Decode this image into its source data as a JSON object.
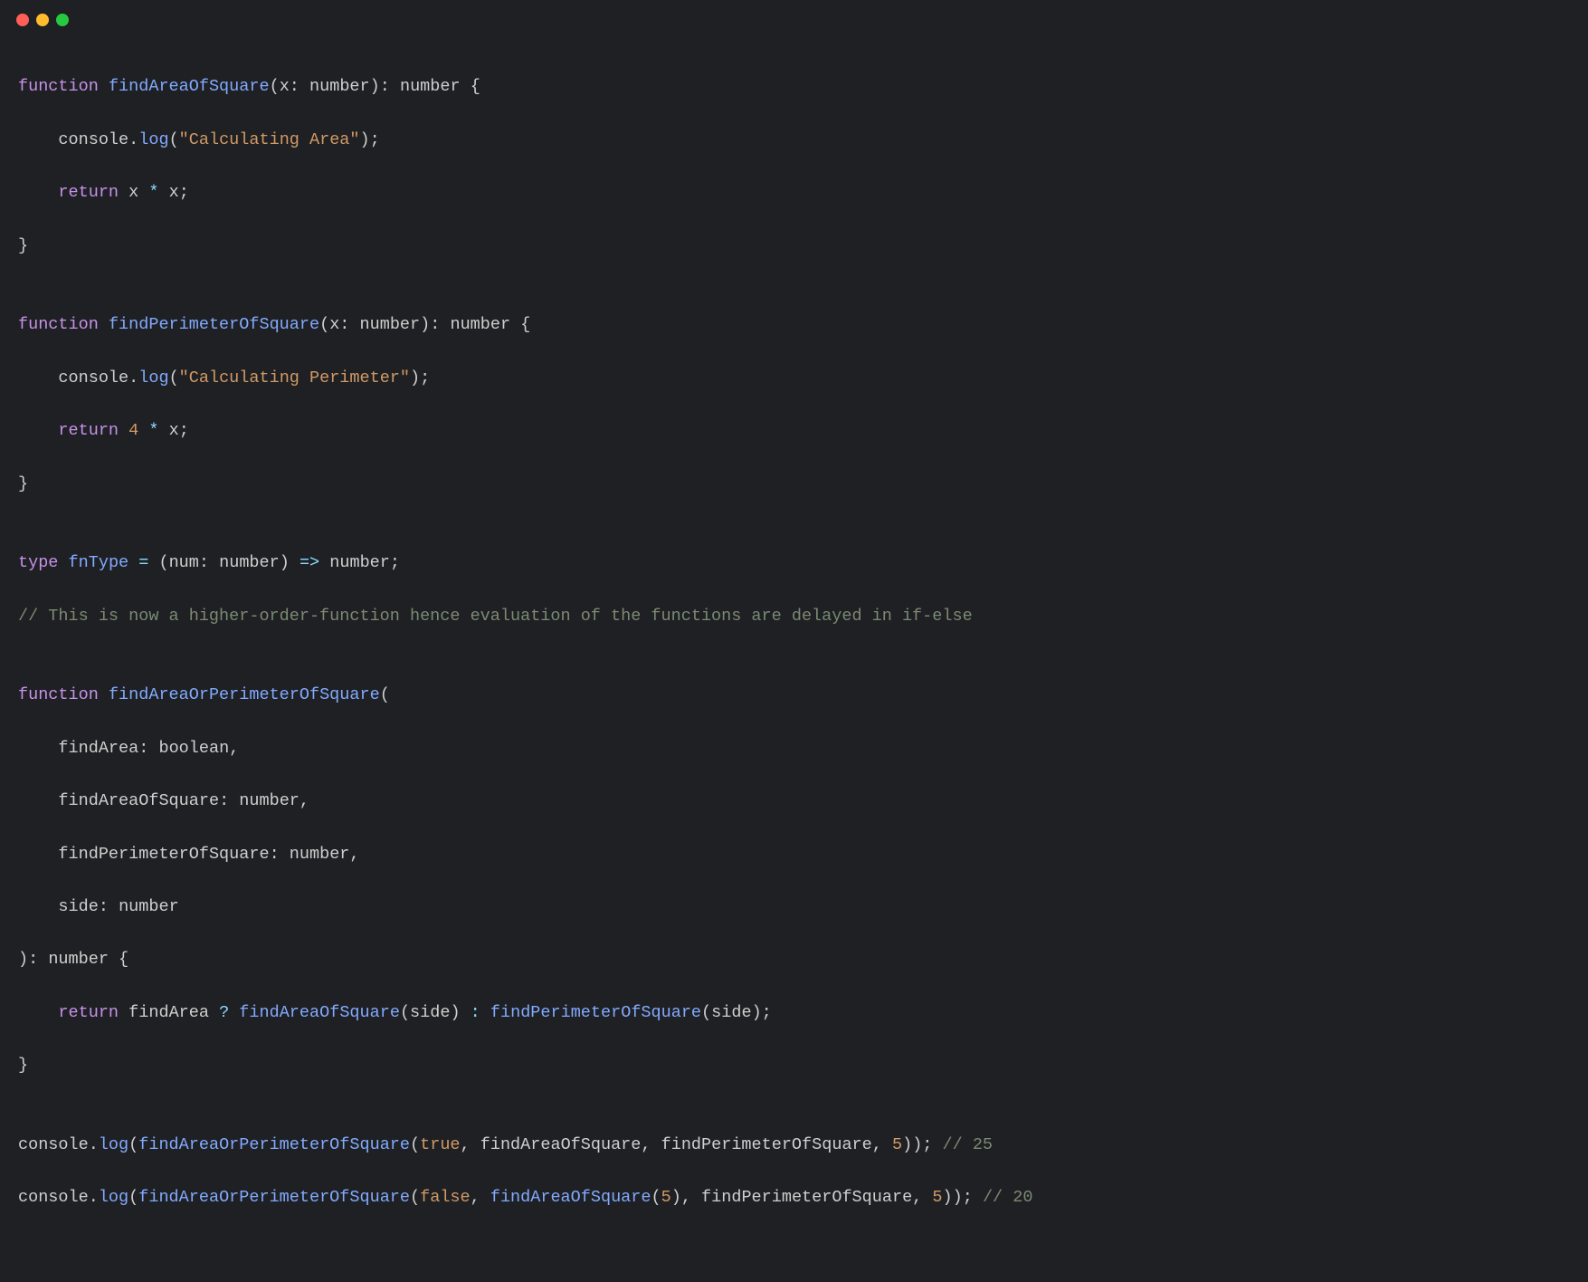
{
  "code": {
    "l1": {
      "kw": "function",
      "fn": "findAreaOfSquare",
      "p": "(",
      "param": "x",
      "colon": ": ",
      "ptype": "number",
      "cp": ")",
      "rcolon": ": ",
      "rtype": "number",
      "ob": " {"
    },
    "l2": {
      "indent": "    ",
      "obj": "console",
      "dot": ".",
      "method": "log",
      "p": "(",
      "str": "\"Calculating Area\"",
      "cp": ")",
      "semi": ";"
    },
    "l3": {
      "indent": "    ",
      "kw": "return",
      "sp": " ",
      "a": "x",
      "op": " * ",
      "b": "x",
      "semi": ";"
    },
    "l4": {
      "cb": "}"
    },
    "l5": {
      "blank": ""
    },
    "l6": {
      "kw": "function",
      "fn": "findPerimeterOfSquare",
      "p": "(",
      "param": "x",
      "colon": ": ",
      "ptype": "number",
      "cp": ")",
      "rcolon": ": ",
      "rtype": "number",
      "ob": " {"
    },
    "l7": {
      "indent": "    ",
      "obj": "console",
      "dot": ".",
      "method": "log",
      "p": "(",
      "str": "\"Calculating Perimeter\"",
      "cp": ")",
      "semi": ";"
    },
    "l8": {
      "indent": "    ",
      "kw": "return",
      "sp": " ",
      "a": "4",
      "op": " * ",
      "b": "x",
      "semi": ";"
    },
    "l9": {
      "cb": "}"
    },
    "l10": {
      "blank": ""
    },
    "l11": {
      "kw": "type",
      "sp": " ",
      "name": "fnType",
      "eq": " = ",
      "p": "(",
      "param": "num",
      "colon": ": ",
      "ptype": "number",
      "cp": ")",
      "arrow": " => ",
      "rtype": "number",
      "semi": ";"
    },
    "l12": {
      "comment": "// This is now a higher-order-function hence evaluation of the functions are delayed in if-else"
    },
    "l13": {
      "blank": ""
    },
    "l14": {
      "kw": "function",
      "fn": "findAreaOrPerimeterOfSquare",
      "p": "("
    },
    "l15": {
      "indent": "    ",
      "param": "findArea",
      "colon": ": ",
      "ptype": "boolean",
      "comma": ","
    },
    "l16": {
      "indent": "    ",
      "param": "findAreaOfSquare",
      "colon": ": ",
      "ptype": "number",
      "comma": ","
    },
    "l17": {
      "indent": "    ",
      "param": "findPerimeterOfSquare",
      "colon": ": ",
      "ptype": "number",
      "comma": ","
    },
    "l18": {
      "indent": "    ",
      "param": "side",
      "colon": ": ",
      "ptype": "number"
    },
    "l19": {
      "cp": ")",
      "rcolon": ": ",
      "rtype": "number",
      "ob": " {"
    },
    "l20": {
      "indent": "    ",
      "kw": "return",
      "sp": " ",
      "cond": "findArea",
      "q": " ? ",
      "fn1": "findAreaOfSquare",
      "p1": "(",
      "arg1": "side",
      "cp1": ")",
      "colon": " : ",
      "fn2": "findPerimeterOfSquare",
      "p2": "(",
      "arg2": "side",
      "cp2": ")",
      "semi": ";"
    },
    "l21": {
      "cb": "}"
    },
    "l22": {
      "blank": ""
    },
    "l23": {
      "obj": "console",
      "dot": ".",
      "method": "log",
      "p": "(",
      "fn": "findAreaOrPerimeterOfSquare",
      "p2": "(",
      "a1": "true",
      "c1": ", ",
      "a2": "findAreaOfSquare",
      "c2": ", ",
      "a3": "findPerimeterOfSquare",
      "c3": ", ",
      "a4": "5",
      "cp2": ")",
      "cp": ")",
      "semi": ";",
      "sp": " ",
      "comment": "// 25"
    },
    "l24": {
      "obj": "console",
      "dot": ".",
      "method": "log",
      "p": "(",
      "fn": "findAreaOrPerimeterOfSquare",
      "p2": "(",
      "a1": "false",
      "c1": ", ",
      "a2": "findAreaOfSquare",
      "p3": "(",
      "a2arg": "5",
      "cp3": ")",
      "c2": ", ",
      "a3": "findPerimeterOfSquare",
      "c3": ", ",
      "a4": "5",
      "cp2": ")",
      "cp": ")",
      "semi": ";",
      "sp": " ",
      "comment": "// 20"
    }
  }
}
